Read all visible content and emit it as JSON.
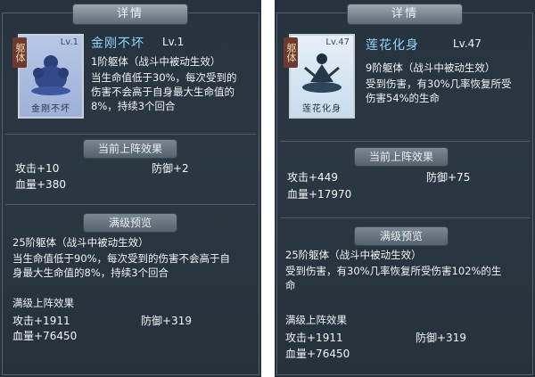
{
  "left": {
    "tab_title": "详情",
    "card": {
      "badge": "躯体",
      "lv": "Lv.1",
      "name": "金刚不坏"
    },
    "skill_name": "金刚不坏",
    "skill_level": "Lv.1",
    "type_line": "1阶躯体（战斗中被动生效）",
    "desc_lines": [
      "当生命值低于30%，每次受到的",
      "伤害不会高于自身最大生命值的",
      "8%，持续3个回合"
    ],
    "current_title": "当前上阵效果",
    "current_stats": {
      "attack": "攻击+10",
      "defense": "防御+2",
      "hp": "血量+380"
    },
    "max_title": "满级预览",
    "max_type_line": "25阶躯体（战斗中被动生效）",
    "max_desc_lines": [
      "当生命值低于90%，每次受到的伤害不会高于自",
      "身最大生命值的8%，持续3个回合"
    ],
    "max_effect_title": "满级上阵效果",
    "max_stats": {
      "attack": "攻击+1911",
      "defense": "防御+319",
      "hp": "血量+76450"
    }
  },
  "right": {
    "tab_title": "详情",
    "card": {
      "badge": "躯体",
      "lv": "Lv.47",
      "name": "莲花化身"
    },
    "skill_name": "莲花化身",
    "skill_level": "Lv.47",
    "type_line": "9阶躯体（战斗中被动生效）",
    "desc_lines": [
      "受到伤害，有30%几率恢复所受",
      "伤害54%的生命"
    ],
    "current_title": "当前上阵效果",
    "current_stats": {
      "attack": "攻击+449",
      "defense": "防御+75",
      "hp": "血量+17970"
    },
    "max_title": "满级预览",
    "max_type_line": "25阶躯体（战斗中被动生效）",
    "max_desc_lines": [
      "受到伤害，有30%几率恢复所受伤害102%的生",
      "命"
    ],
    "max_effect_title": "满级上阵效果",
    "max_stats": {
      "attack": "攻击+1911",
      "defense": "防御+319",
      "hp": "血量+76450"
    }
  }
}
